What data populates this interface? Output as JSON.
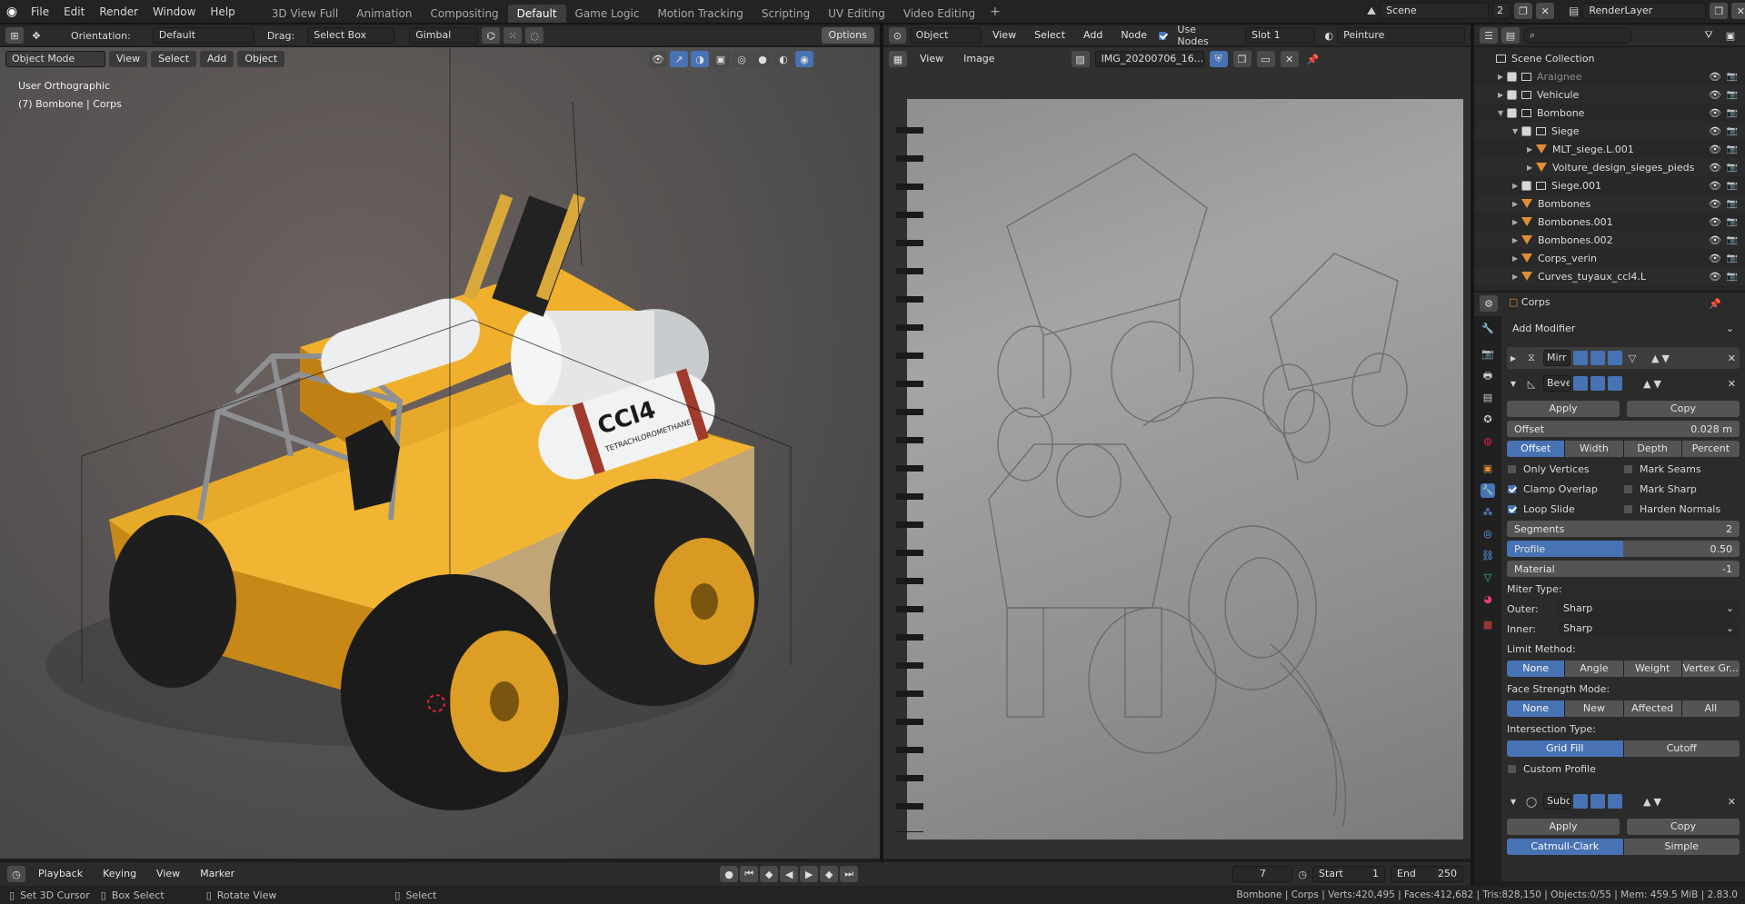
{
  "topbar": {
    "menus": [
      "File",
      "Edit",
      "Render",
      "Window",
      "Help"
    ],
    "workspaces": [
      "3D View Full",
      "Animation",
      "Compositing",
      "Default",
      "Game Logic",
      "Motion Tracking",
      "Scripting",
      "UV Editing",
      "Video Editing"
    ],
    "active_workspace": "Default",
    "scene_label": "Scene",
    "scene_users": "2",
    "view_layer": "RenderLayer"
  },
  "viewport_header": {
    "orientation_label": "Orientation:",
    "orientation_value": "Default",
    "drag_label": "Drag:",
    "drag_value": "Select Box",
    "pivot_value": "Gimbal",
    "options_label": "Options",
    "mode_value": "Object Mode",
    "menus": [
      "View",
      "Select",
      "Add",
      "Object"
    ]
  },
  "viewport": {
    "view_name": "User Orthographic",
    "object_info": "(7) Bombone | Corps",
    "tank_label": "CCl4",
    "tank_sublabel": "TETRACHLOROMETHANE"
  },
  "image_editor": {
    "header_mode": "Object",
    "menus": [
      "View",
      "Select",
      "Add",
      "Node"
    ],
    "use_nodes_label": "Use Nodes",
    "slot": "Slot 1",
    "material": "Peinture",
    "sub_menus": [
      "View",
      "Image"
    ],
    "image_name": "IMG_20200706_16..."
  },
  "outliner": {
    "root": "Scene Collection",
    "items": [
      {
        "label": "Araignee",
        "indent": 1,
        "type": "coll",
        "dim": true
      },
      {
        "label": "Vehicule",
        "indent": 1,
        "type": "coll"
      },
      {
        "label": "Bombone",
        "indent": 1,
        "type": "coll"
      },
      {
        "label": "Siege",
        "indent": 2,
        "type": "coll"
      },
      {
        "label": "MLT_siege.L.001",
        "indent": 3,
        "type": "obj"
      },
      {
        "label": "Voiture_design_sieges_pieds",
        "indent": 3,
        "type": "obj"
      },
      {
        "label": "Siege.001",
        "indent": 2,
        "type": "coll"
      },
      {
        "label": "Bombones",
        "indent": 2,
        "type": "obj"
      },
      {
        "label": "Bombones.001",
        "indent": 2,
        "type": "obj"
      },
      {
        "label": "Bombones.002",
        "indent": 2,
        "type": "obj"
      },
      {
        "label": "Corps_verin",
        "indent": 2,
        "type": "obj"
      },
      {
        "label": "Curves_tuyaux_ccl4.L",
        "indent": 2,
        "type": "curve"
      }
    ]
  },
  "properties": {
    "object_name": "Corps",
    "add_modifier": "Add Modifier",
    "mod1_name": "Mirr",
    "mod2_name": "Beve",
    "apply": "Apply",
    "copy": "Copy",
    "offset_label": "Offset",
    "offset_value": "0.028 m",
    "width_types": [
      "Offset",
      "Width",
      "Depth",
      "Percent"
    ],
    "only_vertices": "Only Vertices",
    "mark_seams": "Mark Seams",
    "clamp_overlap": "Clamp Overlap",
    "mark_sharp": "Mark Sharp",
    "loop_slide": "Loop Slide",
    "harden_normals": "Harden Normals",
    "segments_label": "Segments",
    "segments_value": "2",
    "profile_label": "Profile",
    "profile_value": "0.50",
    "profile_fraction": 0.5,
    "material_label": "Material",
    "material_value": "-1",
    "miter_type": "Miter Type:",
    "outer_label": "Outer:",
    "outer_value": "Sharp",
    "inner_label": "Inner:",
    "inner_value": "Sharp",
    "limit_method": "Limit Method:",
    "limit_options": [
      "None",
      "Angle",
      "Weight",
      "Vertex Gr..."
    ],
    "face_strength": "Face Strength Mode:",
    "face_options": [
      "None",
      "New",
      "Affected",
      "All"
    ],
    "intersection": "Intersection Type:",
    "intersection_options": [
      "Grid Fill",
      "Cutoff"
    ],
    "custom_profile": "Custom Profile",
    "mod3_name": "Subd",
    "subd_options": [
      "Catmull-Clark",
      "Simple"
    ]
  },
  "timeline": {
    "menus": [
      "Playback",
      "Keying",
      "View",
      "Marker"
    ],
    "current_frame": "7",
    "start_label": "Start",
    "start_value": "1",
    "end_label": "End",
    "end_value": "250"
  },
  "statusbar": {
    "hint1": "Set 3D Cursor",
    "hint2": "Box Select",
    "hint3": "Rotate View",
    "hint4": "Select",
    "stats": "Bombone | Corps | Verts:420,495 | Faces:412,682 | Tris:828,150 | Objects:0/55 | Mem: 459.5 MiB | 2.83.0"
  },
  "colors": {
    "accent": "#4772b3",
    "vehicle_yellow": "#e3a321",
    "object_orange": "#e08d36"
  }
}
